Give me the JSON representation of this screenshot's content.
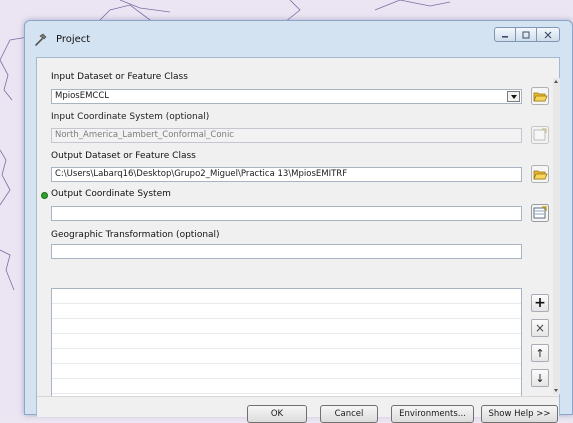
{
  "window": {
    "title": "Project",
    "controls": {
      "minimize": "minimize-icon",
      "maximize": "maximize-icon",
      "close": "close-icon"
    }
  },
  "fields": {
    "input_dataset": {
      "label": "Input Dataset or Feature Class",
      "value": "MpiosEMCCL"
    },
    "input_coord": {
      "label": "Input Coordinate System (optional)",
      "value": "North_America_Lambert_Conformal_Conic"
    },
    "output_dataset": {
      "label": "Output Dataset or Feature Class",
      "value": "C:\\Users\\Labarq16\\Desktop\\Grupo2_Miguel\\Practica 13\\MpiosEMITRF"
    },
    "output_coord": {
      "label": "Output Coordinate System",
      "value": ""
    },
    "geo_transform": {
      "label": "Geographic Transformation (optional)",
      "value": ""
    }
  },
  "list_buttons": {
    "add": "+",
    "remove": "×",
    "up": "↑",
    "down": "↓"
  },
  "buttons": {
    "ok": "OK",
    "cancel": "Cancel",
    "environments": "Environments...",
    "show_help": "Show Help >>"
  },
  "colors": {
    "required_marker": "#2ea12e",
    "title_bar": "#d4e3f2"
  }
}
